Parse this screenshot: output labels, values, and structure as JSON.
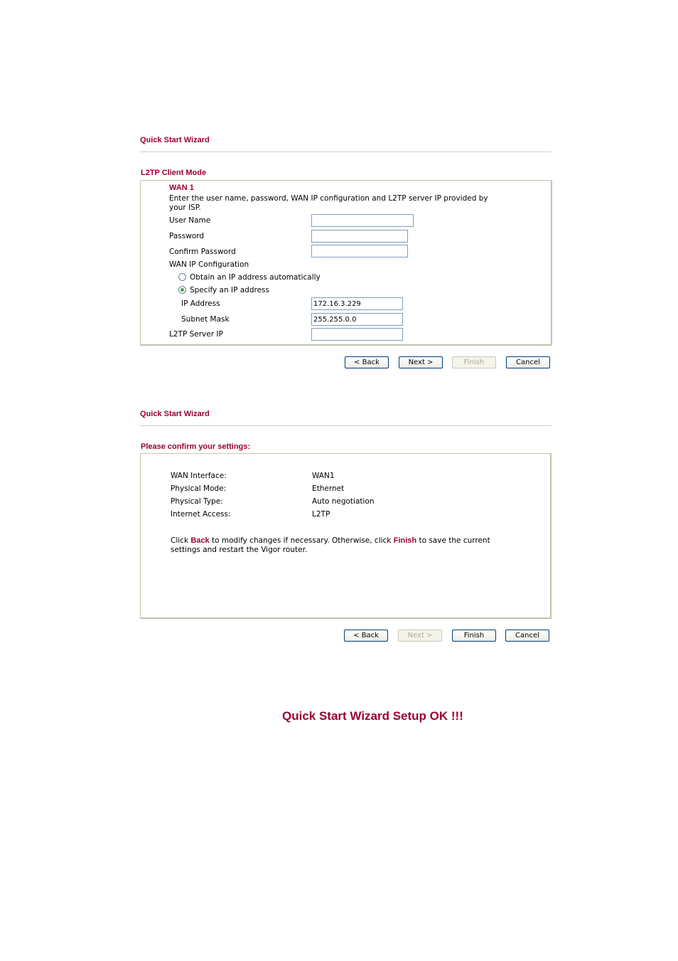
{
  "wizard1": {
    "title": "Quick Start Wizard",
    "section_title": "L2TP Client Mode",
    "wan_label": "WAN 1",
    "description_line1": "Enter the user name, password, WAN IP configuration and L2TP server IP provided by",
    "description_line2": "your ISP.",
    "fields": {
      "user_name": {
        "label": "User Name",
        "value": ""
      },
      "password": {
        "label": "Password",
        "value": ""
      },
      "confirm_password": {
        "label": "Confirm Password",
        "value": ""
      },
      "wan_ip_config_label": "WAN IP Configuration",
      "radio_auto": {
        "label": "Obtain an IP address automatically",
        "selected": false
      },
      "radio_specify": {
        "label": "Specify an IP address",
        "selected": true
      },
      "ip_address": {
        "label": "IP Address",
        "value": "172.16.3.229"
      },
      "subnet_mask": {
        "label": "Subnet Mask",
        "value": "255.255.0.0"
      },
      "l2tp_server_ip": {
        "label": "L2TP Server IP",
        "value": ""
      }
    },
    "buttons": {
      "back": {
        "label": "< Back",
        "enabled": true
      },
      "next": {
        "label": "Next >",
        "enabled": true
      },
      "finish": {
        "label": "Finish",
        "enabled": false
      },
      "cancel": {
        "label": "Cancel",
        "enabled": true
      }
    }
  },
  "wizard2": {
    "title": "Quick Start Wizard",
    "section_title": "Please confirm your settings:",
    "settings": [
      {
        "label": "WAN Interface:",
        "value": "WAN1"
      },
      {
        "label": "Physical Mode:",
        "value": "Ethernet"
      },
      {
        "label": "Physical Type:",
        "value": "Auto negotiation"
      },
      {
        "label": "Internet Access:",
        "value": "L2TP"
      }
    ],
    "note": {
      "part1": "Click ",
      "back_word": "Back",
      "part2": "  to modify changes if necessary. Otherwise, click ",
      "finish_word": "Finish",
      "part3": "  to save the current",
      "line2": "settings and restart the Vigor router."
    },
    "buttons": {
      "back": {
        "label": "< Back",
        "enabled": true
      },
      "next": {
        "label": "Next >",
        "enabled": false
      },
      "finish": {
        "label": "Finish",
        "enabled": true
      },
      "cancel": {
        "label": "Cancel",
        "enabled": true
      }
    }
  },
  "result": {
    "message": "Quick Start Wizard Setup OK !!!"
  }
}
